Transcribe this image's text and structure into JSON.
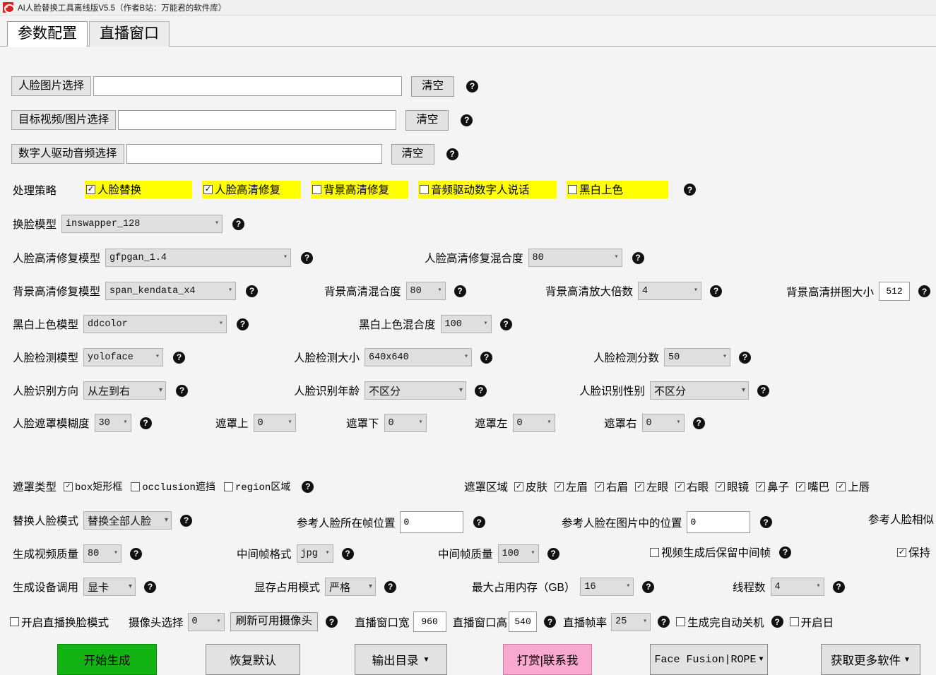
{
  "window": {
    "title": "AI人脸替换工具离线版V5.5（作者B站：万能君的软件库）",
    "icon": "app-logo-icon"
  },
  "tabs": [
    {
      "label": "参数配置",
      "active": true
    },
    {
      "label": "直播窗口",
      "active": false
    }
  ],
  "help_glyph": "?",
  "file_rows": [
    {
      "label": "人脸图片选择",
      "value": "",
      "clear_label": "清空"
    },
    {
      "label": "目标视频/图片选择",
      "value": "",
      "clear_label": "清空"
    },
    {
      "label": "数字人驱动音频选择",
      "value": "",
      "clear_label": "清空"
    }
  ],
  "strategy": {
    "label": "处理策略",
    "options": [
      {
        "label": "人脸替换",
        "checked": true
      },
      {
        "label": "人脸高清修复",
        "checked": true
      },
      {
        "label": "背景高清修复",
        "checked": false
      },
      {
        "label": "音频驱动数字人说话",
        "checked": false
      },
      {
        "label": "黑白上色",
        "checked": false
      }
    ]
  },
  "swap_model": {
    "label": "换脸模型",
    "value": "inswapper_128"
  },
  "face_enhance": {
    "label": "人脸高清修复模型",
    "value": "gfpgan_1.4"
  },
  "face_enhance_blend": {
    "label": "人脸高清修复混合度",
    "value": "80"
  },
  "bg_enhance": {
    "label": "背景高清修复模型",
    "value": "span_kendata_x4"
  },
  "bg_blend": {
    "label": "背景高清混合度",
    "value": "80"
  },
  "bg_scale": {
    "label": "背景高清放大倍数",
    "value": "4"
  },
  "bg_tile": {
    "label": "背景高清拼图大小",
    "value": "512"
  },
  "color_model": {
    "label": "黑白上色模型",
    "value": "ddcolor"
  },
  "color_blend": {
    "label": "黑白上色混合度",
    "value": "100"
  },
  "detect_model": {
    "label": "人脸检测模型",
    "value": "yoloface"
  },
  "detect_size": {
    "label": "人脸检测大小",
    "value": "640x640"
  },
  "detect_score": {
    "label": "人脸检测分数",
    "value": "50"
  },
  "recog_order": {
    "label": "人脸识别方向",
    "value": "从左到右"
  },
  "recog_age": {
    "label": "人脸识别年龄",
    "value": "不区分"
  },
  "recog_gender": {
    "label": "人脸识别性别",
    "value": "不区分"
  },
  "mask_blur": {
    "label": "人脸遮罩模糊度",
    "value": "30"
  },
  "mask_top": {
    "label": "遮罩上",
    "value": "0"
  },
  "mask_bottom": {
    "label": "遮罩下",
    "value": "0"
  },
  "mask_left": {
    "label": "遮罩左",
    "value": "0"
  },
  "mask_right": {
    "label": "遮罩右",
    "value": "0"
  },
  "mask_type": {
    "label": "遮罩类型",
    "options": [
      {
        "label": "box矩形框",
        "checked": true
      },
      {
        "label": "occlusion遮挡",
        "checked": false
      },
      {
        "label": "region区域",
        "checked": false
      }
    ]
  },
  "mask_region": {
    "label": "遮罩区域",
    "options": [
      {
        "label": "皮肤",
        "checked": true
      },
      {
        "label": "左眉",
        "checked": true
      },
      {
        "label": "右眉",
        "checked": true
      },
      {
        "label": "左眼",
        "checked": true
      },
      {
        "label": "右眼",
        "checked": true
      },
      {
        "label": "眼镜",
        "checked": true
      },
      {
        "label": "鼻子",
        "checked": true
      },
      {
        "label": "嘴巴",
        "checked": true
      },
      {
        "label": "上唇",
        "checked": true
      }
    ]
  },
  "replace_mode": {
    "label": "替换人脸模式",
    "value": "替换全部人脸"
  },
  "ref_frame_pos": {
    "label": "参考人脸所在帧位置",
    "value": "0"
  },
  "ref_img_pos": {
    "label": "参考人脸在图片中的位置",
    "value": "0"
  },
  "ref_similarity": {
    "label": "参考人脸相似"
  },
  "video_quality": {
    "label": "生成视频质量",
    "value": "80"
  },
  "frame_format": {
    "label": "中间帧格式",
    "value": "jpg"
  },
  "frame_quality": {
    "label": "中间帧质量",
    "value": "100"
  },
  "keep_frames": {
    "label": "视频生成后保留中间帧",
    "checked": false
  },
  "keep_partial": {
    "label": "保持",
    "checked": true
  },
  "device": {
    "label": "生成设备调用",
    "value": "显卡"
  },
  "vram_mode": {
    "label": "显存占用模式",
    "value": "严格"
  },
  "max_memory": {
    "label": "最大占用内存（GB）",
    "value": "16"
  },
  "threads": {
    "label": "线程数",
    "value": "4"
  },
  "live_mode": {
    "label": "开启直播换脸模式",
    "checked": false
  },
  "camera_select": {
    "label": "摄像头选择",
    "value": "0"
  },
  "refresh_camera": {
    "label": "刷新可用摄像头"
  },
  "live_width": {
    "label": "直播窗口宽",
    "value": "960"
  },
  "live_height": {
    "label": "直播窗口高",
    "value": "540"
  },
  "live_fps": {
    "label": "直播帧率",
    "value": "25"
  },
  "auto_shutdown": {
    "label": "生成完自动关机",
    "checked": false
  },
  "enable_partial": {
    "label": "开启日",
    "checked": false
  },
  "buttons": [
    {
      "label": "开始生成",
      "style": "green",
      "caret": false
    },
    {
      "label": "恢复默认",
      "style": "grey",
      "caret": false
    },
    {
      "label": "输出目录",
      "style": "grey",
      "caret": true
    },
    {
      "label": "打赏|联系我",
      "style": "pink",
      "caret": false
    },
    {
      "label": "Face Fusion|ROPE",
      "style": "mono",
      "caret": true
    },
    {
      "label": "获取更多软件",
      "style": "grey",
      "caret": true
    }
  ],
  "colors": {
    "highlight": "#ffff00",
    "start_button": "#12b312",
    "donate_button": "#f9a8d0",
    "window_bg": "#f4f4f4"
  }
}
